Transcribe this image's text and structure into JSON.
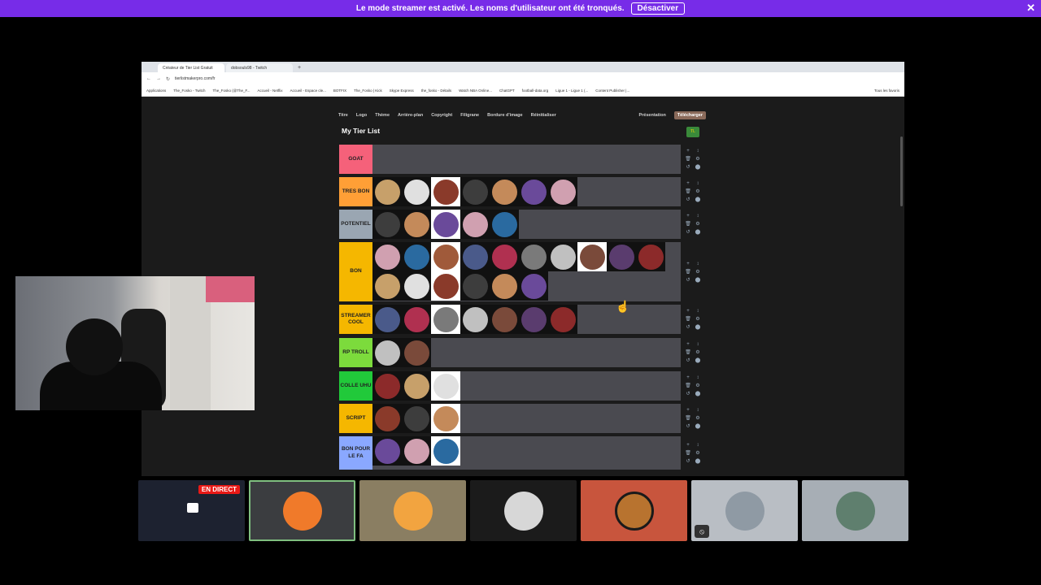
{
  "banner": {
    "text": "Le mode streamer est activé. Les noms d'utilisateur ont été tronqués.",
    "button": "Désactiver",
    "close": "✕"
  },
  "browser": {
    "tabs": [
      "Créateur de Tier List Gratuit",
      "dobsouls98 - Twitch"
    ],
    "url": "tierlistmakerpro.com/fr",
    "bookmarks": [
      "Applications",
      "The_Fosko - Twitch",
      "The_Fosko (@The_F...",
      "Accueil - Netflix",
      "Accueil - Espace cle...",
      "BOTFIX",
      "The_Fosko | Kick",
      "Skype Express",
      "the_fosko - Détails",
      "Watch NBA Online...",
      "ChatGPT",
      "football-data.org",
      "Ligue 1 - Ligue 1 (...",
      "Content Publisher |...",
      "Tous les favoris"
    ]
  },
  "toolbar": {
    "items": [
      "Titre",
      "Logo",
      "Thème",
      "Arrière-plan",
      "Copyright",
      "Filigrane",
      "Bordure d'image",
      "Réinitialiser"
    ],
    "presentation": "Présentation",
    "download": "Télécharger"
  },
  "tierlist": {
    "title": "My Tier List",
    "logo_text": "TL",
    "tiers": [
      {
        "label": "GOAT",
        "color": "#f5617a",
        "count": 0
      },
      {
        "label": "TRES BON",
        "color": "#ff9f36",
        "count": 7
      },
      {
        "label": "POTENTIEL",
        "color": "#9aa6b2",
        "count": 5
      },
      {
        "label": "BON",
        "color": "#f5b700",
        "count": 16
      },
      {
        "label": "STREAMER COOL",
        "color": "#f5b700",
        "count": 7
      },
      {
        "label": "RP TROLL",
        "color": "#7cdb3c",
        "count": 2
      },
      {
        "label": "COLLE UHU",
        "color": "#21c93a",
        "count": 3
      },
      {
        "label": "SCRIPT",
        "color": "#f5b700",
        "count": 3
      },
      {
        "label": "BON POUR LE FA",
        "color": "#8aa8ff",
        "count": 3
      }
    ]
  },
  "guests": {
    "live_label": "EN DIRECT"
  }
}
